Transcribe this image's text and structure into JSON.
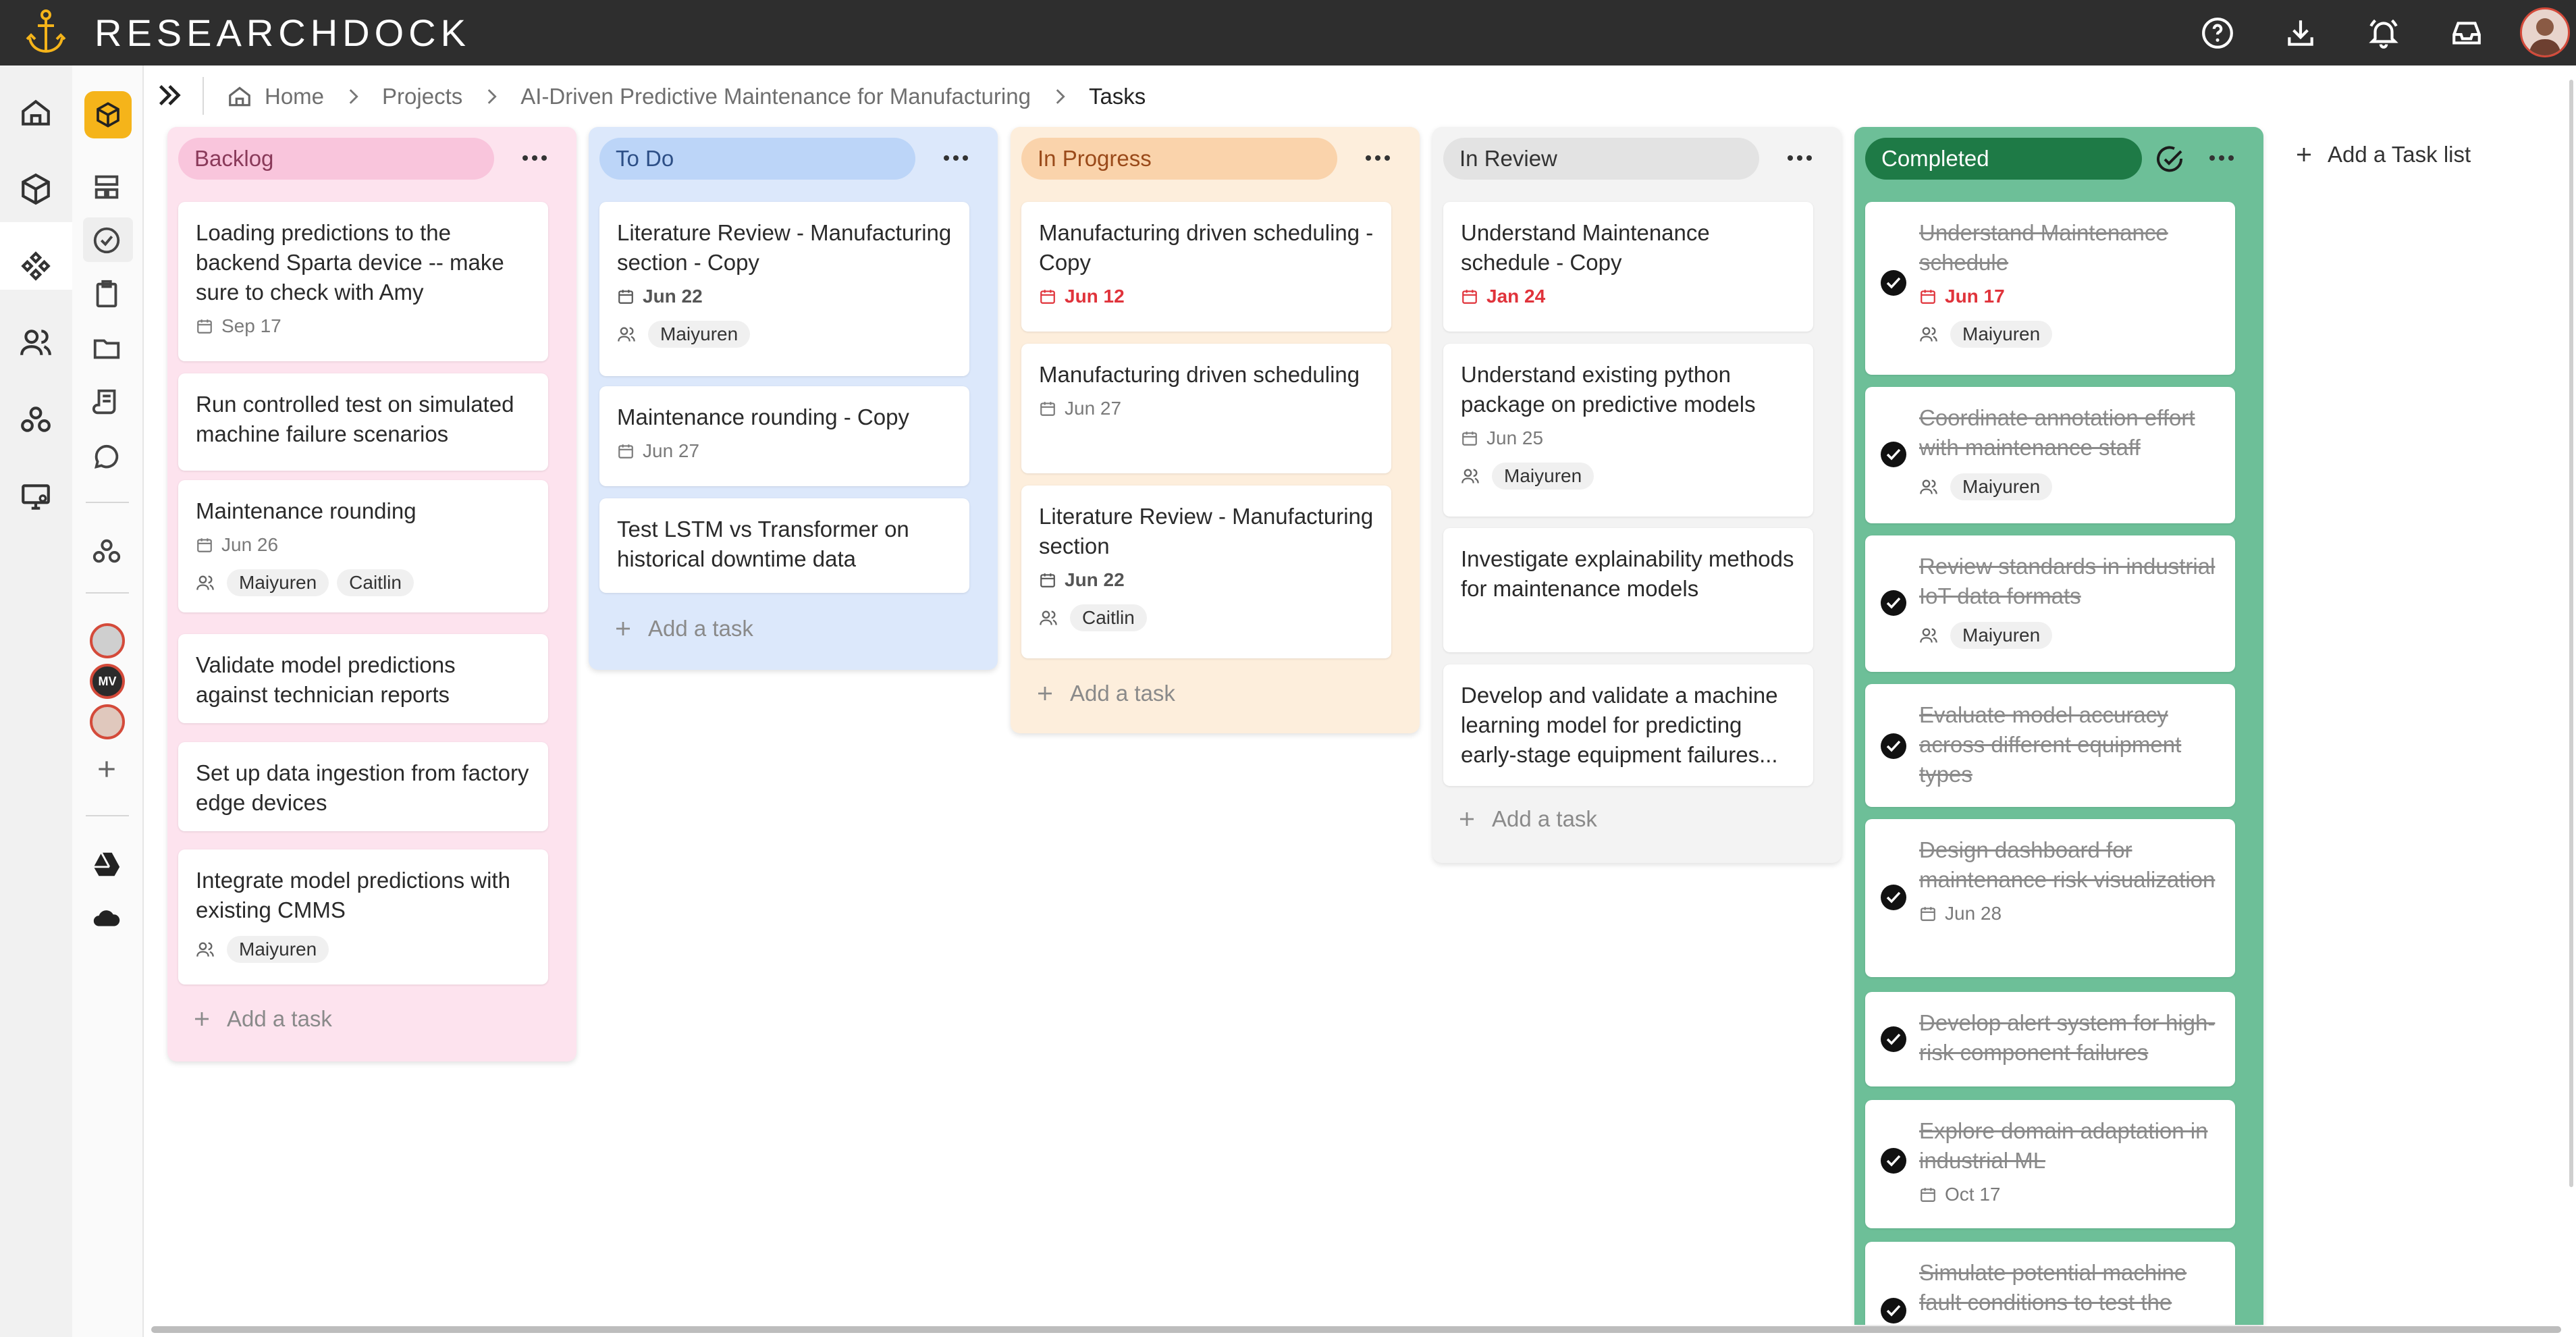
{
  "app": {
    "name": "RESEARCHDOCK"
  },
  "header_icons": [
    "help-icon",
    "download-icon",
    "bell-icon",
    "inbox-icon"
  ],
  "breadcrumb": {
    "home": "Home",
    "projects": "Projects",
    "project": "AI-Driven Predictive Maintenance for Manufacturing",
    "current": "Tasks"
  },
  "colors": {
    "backlog_bg": "#fde3ee",
    "backlog_head": "#f9c5dc",
    "todo_bg": "#dce8fb",
    "todo_head": "#bcd5f8",
    "progress_bg": "#fdeedc",
    "progress_head": "#fad3ab",
    "review_bg": "#f3f3f3",
    "review_head": "#e3e3e3",
    "done_bg": "#6dbf98",
    "done_head": "#1e7a46",
    "due_red": "#e0333b",
    "brand_accent": "#f5b41a"
  },
  "columns": {
    "backlog": {
      "title": "Backlog",
      "add": "Add a task",
      "cards": [
        {
          "title": "Loading predictions to the backend Sparta device -- make sure to check with Amy",
          "date": "Sep 17"
        },
        {
          "title": "Run controlled test on simulated machine failure scenarios"
        },
        {
          "title": "Maintenance rounding",
          "date": "Jun 26",
          "people": [
            "Maiyuren",
            "Caitlin"
          ]
        },
        {
          "title": "Validate model predictions against technician reports"
        },
        {
          "title": "Set up data ingestion from factory edge devices"
        },
        {
          "title": "Integrate model predictions with existing CMMS",
          "people": [
            "Maiyuren"
          ]
        }
      ]
    },
    "todo": {
      "title": "To Do",
      "add": "Add a task",
      "cards": [
        {
          "title": "Literature Review - Manufacturing section - Copy",
          "date": "Jun 22",
          "people": [
            "Maiyuren"
          ]
        },
        {
          "title": "Maintenance rounding - Copy",
          "date": "Jun 27"
        },
        {
          "title": "Test LSTM vs Transformer on historical downtime data"
        }
      ]
    },
    "progress": {
      "title": "In Progress",
      "add": "Add a task",
      "cards": [
        {
          "title": "Manufacturing driven scheduling - Copy",
          "date": "Jun 12"
        },
        {
          "title": "Manufacturing driven scheduling",
          "date": "Jun 27"
        },
        {
          "title": "Literature Review - Manufacturing section",
          "date": "Jun 22",
          "people": [
            "Caitlin"
          ]
        }
      ]
    },
    "review": {
      "title": "In Review",
      "add": "Add a task",
      "cards": [
        {
          "title": "Understand Maintenance schedule - Copy",
          "date": "Jan 24"
        },
        {
          "title": "Understand existing python package on predictive models",
          "date": "Jun 25",
          "people": [
            "Maiyuren"
          ]
        },
        {
          "title": "Investigate explainability methods for maintenance models"
        },
        {
          "title": "Develop and validate a machine learning model for predicting early-stage equipment failures..."
        }
      ]
    },
    "done": {
      "title": "Completed",
      "cards": [
        {
          "title": "Understand Maintenance schedule",
          "date": "Jun 17",
          "people": [
            "Maiyuren"
          ]
        },
        {
          "title": "Coordinate annotation effort with maintenance staff",
          "people": [
            "Maiyuren"
          ]
        },
        {
          "title": "Review standards in industrial IoT data formats",
          "people": [
            "Maiyuren"
          ]
        },
        {
          "title": "Evaluate model accuracy across different equipment types"
        },
        {
          "title": "Design dashboard for maintenance risk visualization",
          "date": "Jun 28"
        },
        {
          "title": "Develop alert system for high-risk component failures"
        },
        {
          "title": "Explore domain adaptation in industrial ML",
          "date": "Oct 17"
        },
        {
          "title": "Simulate potential machine fault conditions to test the"
        }
      ]
    }
  },
  "add_list": "Add a Task list",
  "mini_avatar_initials": "MV"
}
